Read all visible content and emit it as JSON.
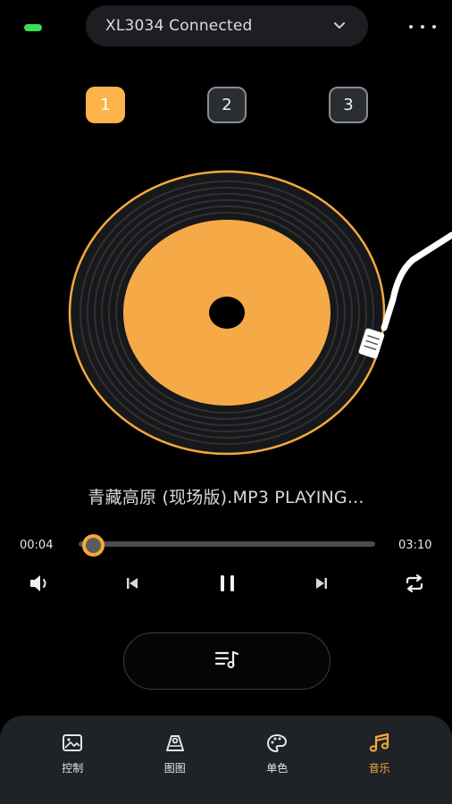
{
  "header": {
    "device_name": "XL3034 Connected",
    "battery_color": "#3ddc55",
    "dropdown_icon": "chevron-down-icon",
    "more_icon": "more-dots-icon"
  },
  "tabs": [
    {
      "label": "1",
      "active": true
    },
    {
      "label": "2",
      "active": false
    },
    {
      "label": "3",
      "active": false
    }
  ],
  "player": {
    "song_title": "青藏高原 (现场版).MP3 PLAYING...",
    "elapsed": "00:04",
    "duration": "03:10",
    "progress": 0.02,
    "accent_color": "#f5a93c"
  },
  "controls": {
    "volume_icon": "volume-icon",
    "prev_icon": "skip-previous-icon",
    "pause_icon": "pause-icon",
    "next_icon": "skip-next-icon",
    "repeat_icon": "repeat-icon",
    "playlist_icon": "playlist-music-icon"
  },
  "nav": [
    {
      "label": "控制",
      "icon": "image-control-icon",
      "active": false
    },
    {
      "label": "图图",
      "icon": "pattern-icon",
      "active": false
    },
    {
      "label": "单色",
      "icon": "palette-icon",
      "active": false
    },
    {
      "label": "音乐",
      "icon": "music-note-icon",
      "active": true
    }
  ]
}
